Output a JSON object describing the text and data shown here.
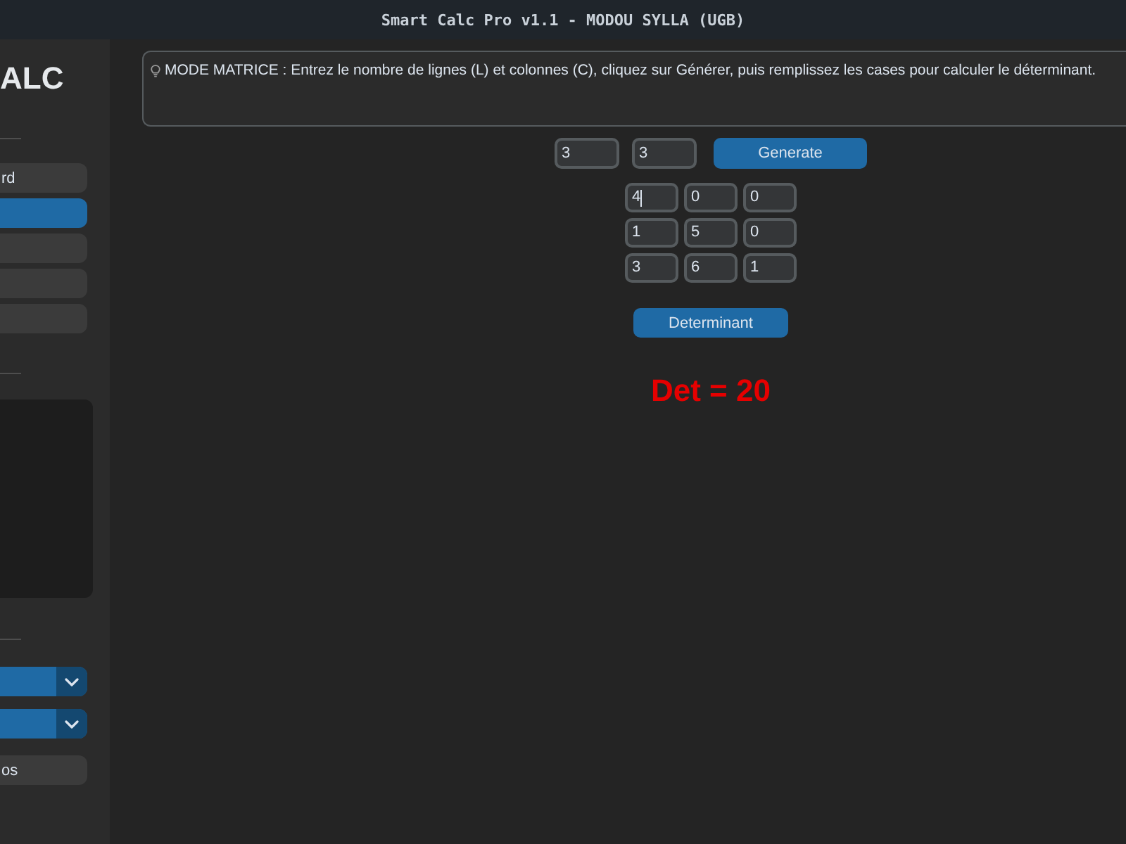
{
  "window": {
    "title": "Smart Calc Pro v1.1 - MODOU SYLLA (UGB)"
  },
  "sidebar": {
    "logo": "ALC",
    "menu": [
      {
        "label": "rd",
        "selected": false
      },
      {
        "selected": true
      },
      {
        "selected": false
      },
      {
        "selected": false
      },
      {
        "selected": false
      }
    ],
    "bottom_button": "os"
  },
  "hint": {
    "text": "MODE MATRICE : Entrez le nombre de lignes (L) et colonnes (C), cliquez sur Générer, puis remplissez les cases pour calculer le déterminant."
  },
  "matrix": {
    "rows_value": "3",
    "cols_value": "3",
    "generate_button": "Generate",
    "cells": [
      [
        {
          "value": "4",
          "focused": true
        },
        {
          "value": "0",
          "focused": false
        },
        {
          "value": "0",
          "focused": false
        }
      ],
      [
        {
          "value": "1",
          "focused": false
        },
        {
          "value": "5",
          "focused": false
        },
        {
          "value": "0",
          "focused": false
        }
      ],
      [
        {
          "value": "3",
          "focused": false
        },
        {
          "value": "6",
          "focused": false
        },
        {
          "value": "1",
          "focused": false
        }
      ]
    ],
    "determinant_button": "Determinant",
    "result": "Det = 20"
  }
}
